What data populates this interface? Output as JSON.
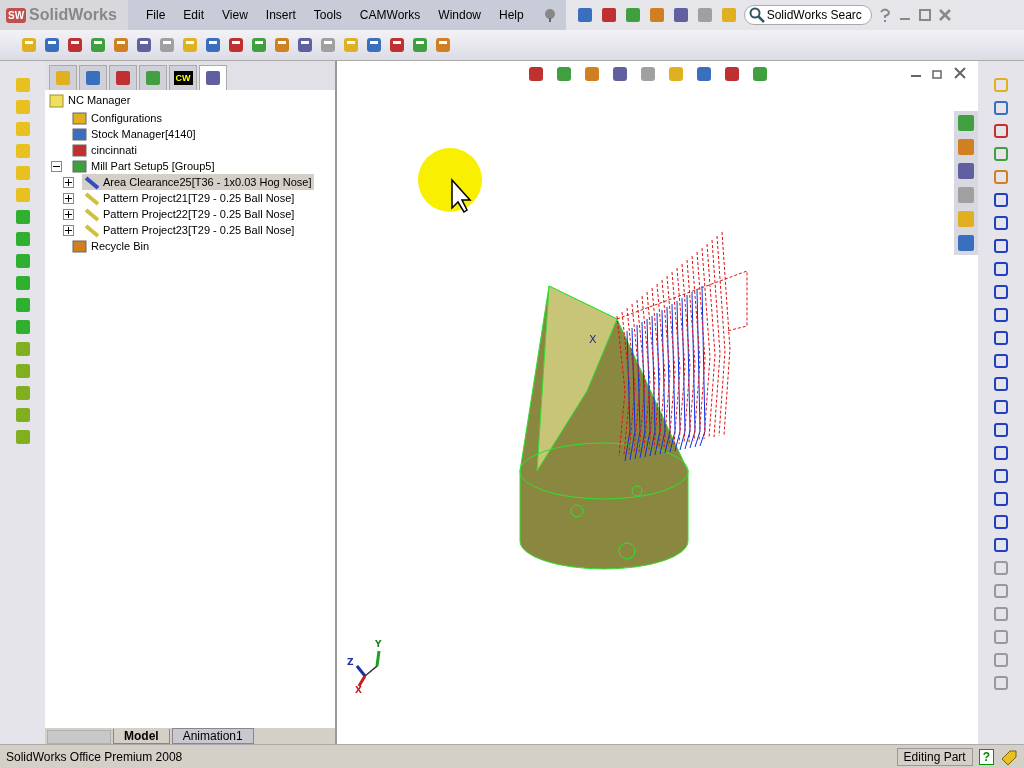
{
  "app": {
    "logo_mark": "SW",
    "logo_text": "SolidWorks"
  },
  "menu": [
    "File",
    "Edit",
    "View",
    "Insert",
    "Tools",
    "CAMWorks",
    "Window",
    "Help"
  ],
  "search": {
    "placeholder": "SolidWorks Searc"
  },
  "panel_tabs": [
    {
      "selected": false
    },
    {
      "selected": false
    },
    {
      "selected": false
    },
    {
      "selected": false
    },
    {
      "label": "CW",
      "selected": false
    },
    {
      "selected": true
    }
  ],
  "tree": [
    {
      "label": "NC Manager",
      "selected": false,
      "children": [
        {
          "label": "Configurations",
          "selected": false
        },
        {
          "label": "Stock Manager[4140]",
          "selected": false
        },
        {
          "label": "cincinnati",
          "selected": false
        },
        {
          "label": "Mill Part Setup5 [Group5]",
          "selected": false,
          "expanded": true,
          "children": [
            {
              "label": "Area Clearance25[T36 - 1x0.03 Hog Nose]",
              "selected": true,
              "expanded": false
            },
            {
              "label": "Pattern Project21[T29 - 0.25 Ball Nose]",
              "selected": false,
              "expanded": false
            },
            {
              "label": "Pattern Project22[T29 - 0.25 Ball Nose]",
              "selected": false,
              "expanded": false
            },
            {
              "label": "Pattern Project23[T29 - 0.25 Ball Nose]",
              "selected": false,
              "expanded": false
            }
          ]
        },
        {
          "label": "Recycle Bin",
          "selected": false
        }
      ]
    }
  ],
  "bottom_tabs": [
    {
      "label": "Model",
      "selected": true
    },
    {
      "label": "Animation1",
      "selected": false
    }
  ],
  "viewport": {
    "origin_label": "X",
    "triad_labels": [
      "X",
      "Y",
      "Z"
    ]
  },
  "status_bar": {
    "product": "SolidWorks Office Premium 2008",
    "mode": "Editing Part",
    "help": "?"
  }
}
